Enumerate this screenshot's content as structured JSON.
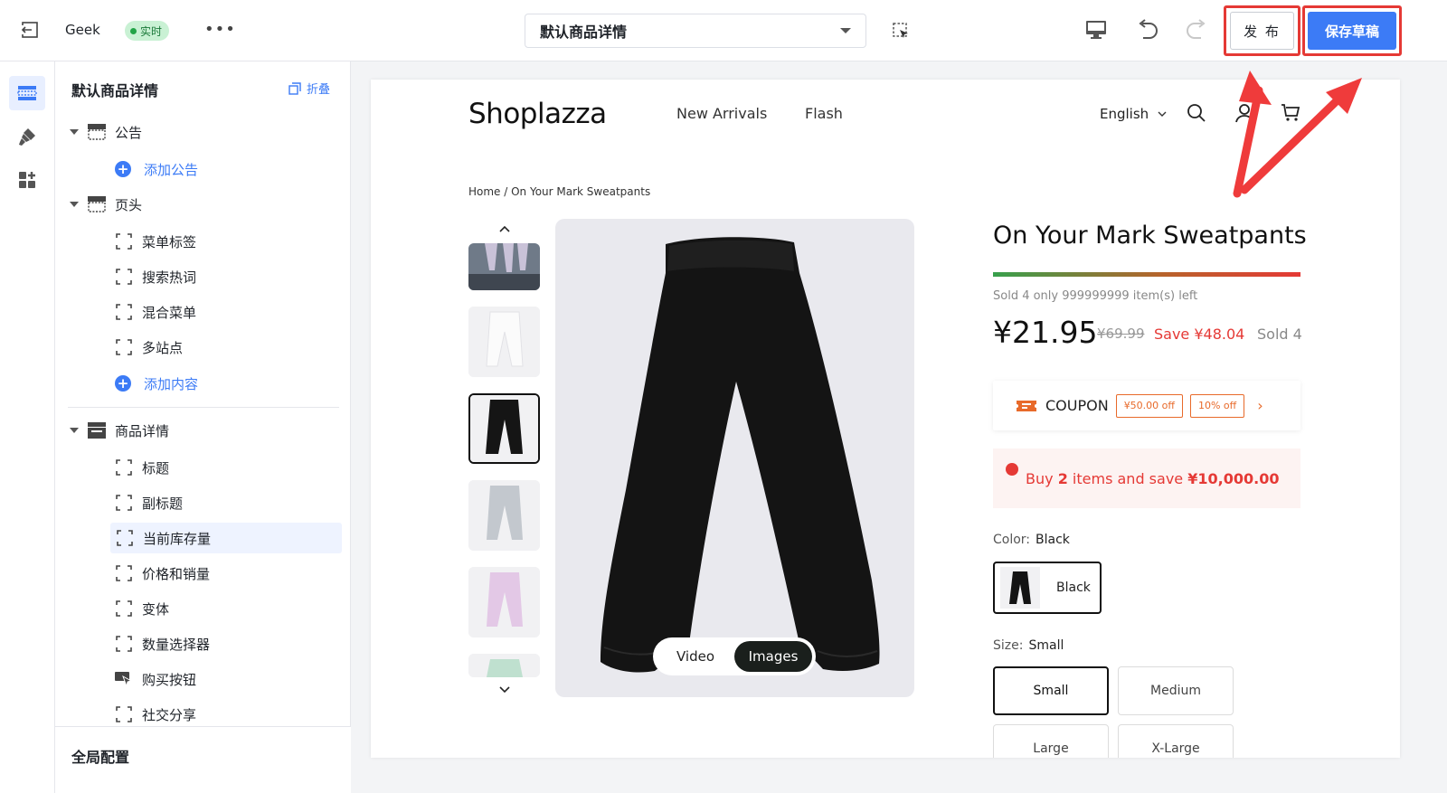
{
  "topbar": {
    "store_name": "Geek",
    "live_badge": "实时",
    "more": "•••",
    "template_select": "默认商品详情",
    "publish_label": "发 布",
    "save_label": "保存草稿"
  },
  "panel": {
    "title": "默认商品详情",
    "collapse_label": "折叠",
    "sections": [
      {
        "label": "公告",
        "children": [
          {
            "label": "添加公告",
            "type": "add"
          }
        ]
      },
      {
        "label": "页头",
        "children": [
          {
            "label": "菜单标签"
          },
          {
            "label": "搜索热词"
          },
          {
            "label": "混合菜单"
          },
          {
            "label": "多站点"
          },
          {
            "label": "添加内容",
            "type": "add"
          }
        ]
      },
      {
        "label": "商品详情",
        "children": [
          {
            "label": "标题"
          },
          {
            "label": "副标题"
          },
          {
            "label": "当前库存量",
            "selected": true
          },
          {
            "label": "价格和销量"
          },
          {
            "label": "变体"
          },
          {
            "label": "数量选择器"
          },
          {
            "label": "购买按钮"
          },
          {
            "label": "社交分享"
          }
        ]
      }
    ],
    "footer_label": "全局配置"
  },
  "preview": {
    "logo": "Shoplazza",
    "nav": [
      "New Arrivals",
      "Flash"
    ],
    "language": "English",
    "breadcrumb": "Home / On Your Mark Sweatpants",
    "media_toggle": {
      "video": "Video",
      "images": "Images"
    },
    "product": {
      "title": "On Your Mark Sweatpants",
      "stock_text": "Sold 4 only 999999999 item(s) left",
      "price": "¥21.95",
      "compare_price": "¥69.99",
      "save_text": "Save ¥48.04",
      "sold_text": "Sold 4",
      "coupon": {
        "label": "COUPON",
        "tags": [
          "¥50.00 off",
          "10% off"
        ]
      },
      "promo": {
        "prefix": "Buy ",
        "qty": "2",
        "suffix": " items and save ",
        "amount": "¥10,000.00"
      },
      "color": {
        "label": "Color:",
        "value": "Black",
        "options": [
          "Black"
        ]
      },
      "size": {
        "label": "Size:",
        "value": "Small",
        "options": [
          "Small",
          "Medium",
          "Large",
          "X-Large"
        ]
      }
    }
  },
  "colors": {
    "accent": "#3c7bf6",
    "danger": "#e53935",
    "coupon": "#e86a2a",
    "live": "#22a447"
  }
}
